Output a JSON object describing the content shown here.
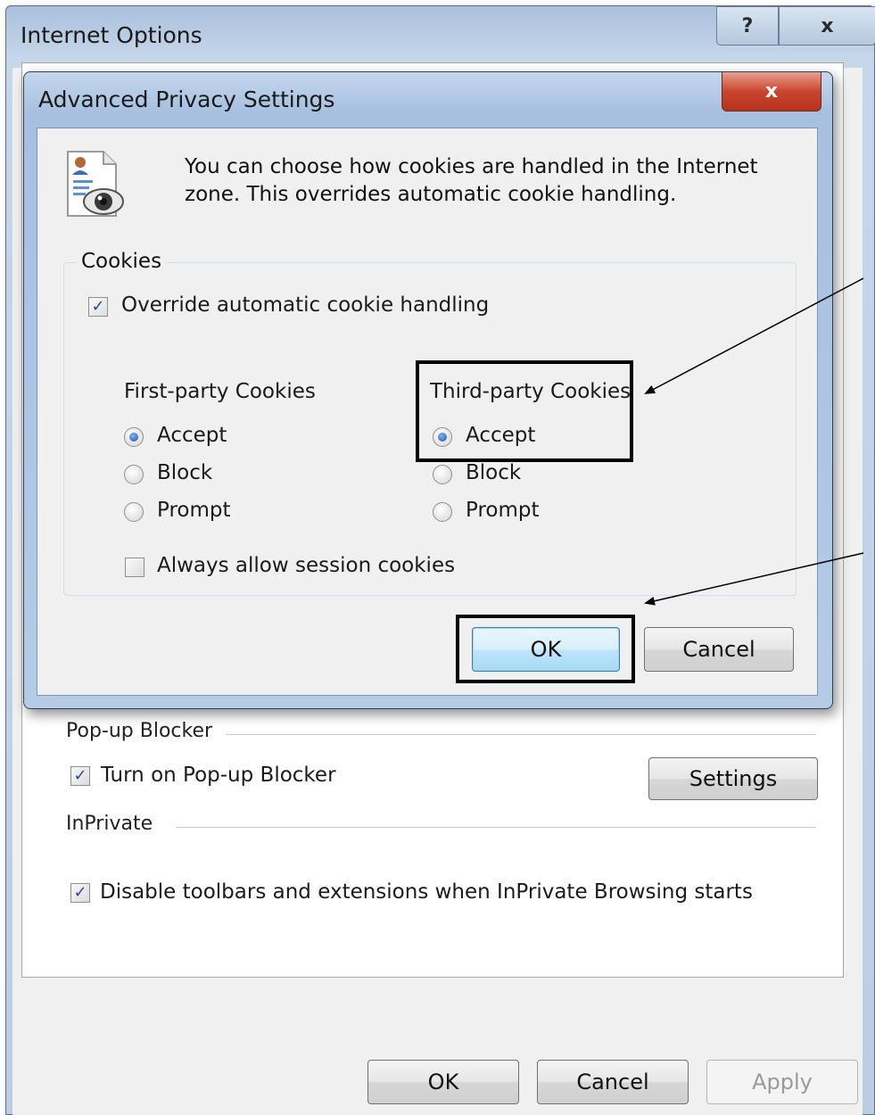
{
  "outer_window": {
    "title": "Internet Options",
    "help_glyph": "?",
    "close_glyph": "x",
    "popup_group_label": "Pop-up Blocker",
    "popup_checkbox_label": "Turn on Pop-up Blocker",
    "popup_checked": true,
    "settings_button": "Settings",
    "inprivate_group_label": "InPrivate",
    "inprivate_checkbox_label": "Disable toolbars and extensions when InPrivate Browsing starts",
    "inprivate_checked": true,
    "ok_button": "OK",
    "cancel_button": "Cancel",
    "apply_button": "Apply"
  },
  "dialog": {
    "title": "Advanced Privacy Settings",
    "close_glyph": "x",
    "info_text": "You can choose how cookies are handled in the Internet zone.  This overrides automatic cookie handling.",
    "cookies_group_label": "Cookies",
    "override_label": "Override automatic cookie handling",
    "override_checked": true,
    "first_party": {
      "heading": "First-party Cookies",
      "options": [
        "Accept",
        "Block",
        "Prompt"
      ],
      "selected": "Accept"
    },
    "third_party": {
      "heading": "Third-party Cookies",
      "options": [
        "Accept",
        "Block",
        "Prompt"
      ],
      "selected": "Accept"
    },
    "session_label": "Always allow session cookies",
    "session_checked": false,
    "ok_button": "OK",
    "cancel_button": "Cancel"
  },
  "icons": {
    "info": "privacy-document-eye-icon",
    "check": "checkmark-icon"
  },
  "colors": {
    "dialog_frame": "#a7c0df",
    "close_button": "#c9452f",
    "default_button": "#bee6fd",
    "annotation": "#000000"
  }
}
